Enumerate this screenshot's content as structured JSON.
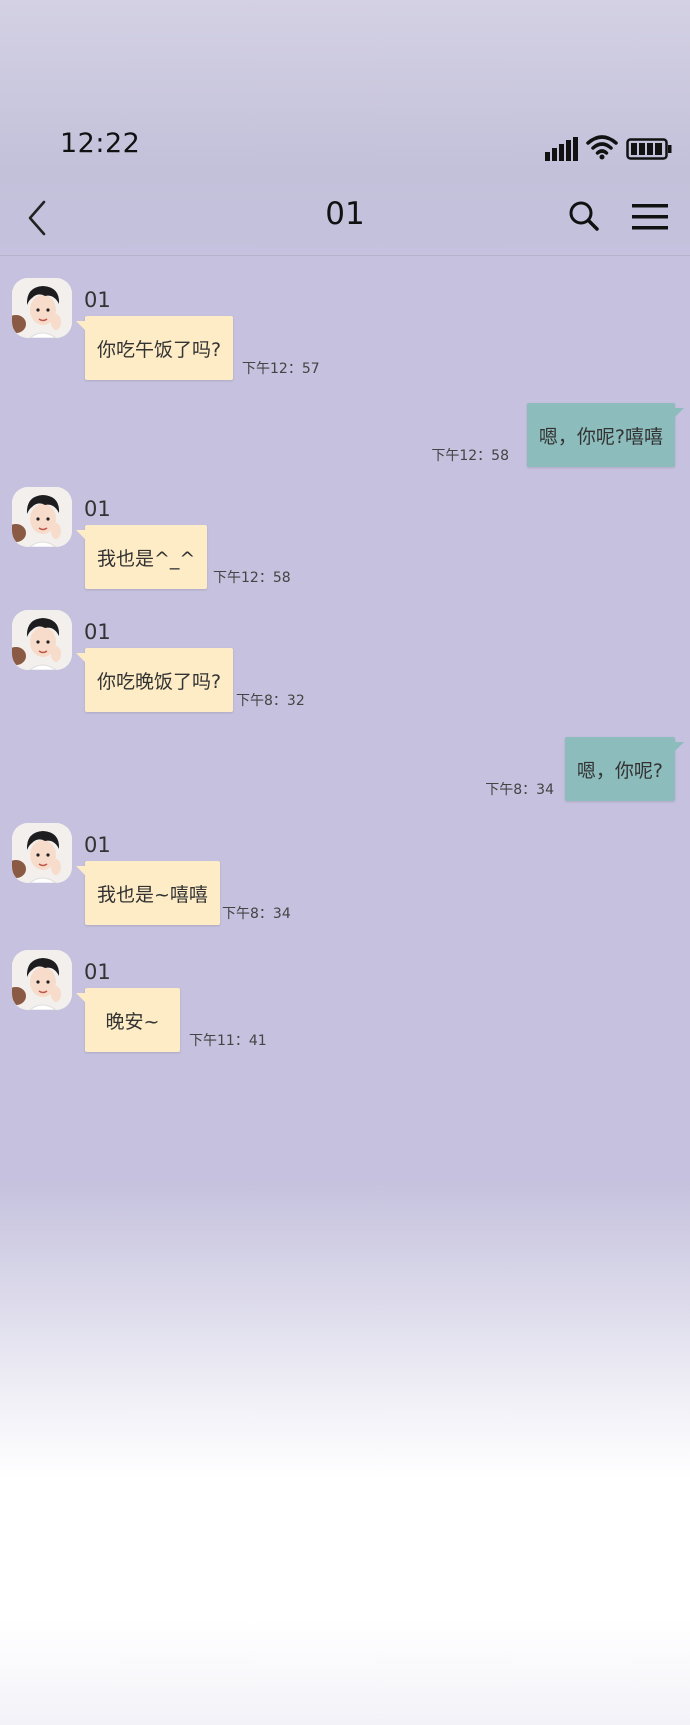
{
  "status_bar": {
    "time": "12:22",
    "icons": [
      "signal-icon",
      "wifi-icon",
      "battery-icon"
    ]
  },
  "navbar": {
    "title": "01",
    "icons": [
      "back-icon",
      "search-icon",
      "menu-icon"
    ]
  },
  "colors": {
    "incoming_bubble": "#fdecc6",
    "outgoing_bubble": "#8cbcbc",
    "background": "#c5c1de"
  },
  "messages": [
    {
      "direction": "in",
      "sender": "01",
      "text": "你吃午饭了吗?",
      "time": "下午12：57"
    },
    {
      "direction": "out",
      "text": "嗯，你呢?嘻嘻",
      "time": "下午12：58"
    },
    {
      "direction": "in",
      "sender": "01",
      "text": "我也是^_^",
      "time": "下午12：58"
    },
    {
      "direction": "in",
      "sender": "01",
      "text": "你吃晚饭了吗?",
      "time": "下午8：32"
    },
    {
      "direction": "out",
      "text": "嗯，你呢?",
      "time": "下午8：34"
    },
    {
      "direction": "in",
      "sender": "01",
      "text": "我也是~嘻嘻",
      "time": "下午8：34"
    },
    {
      "direction": "in",
      "sender": "01",
      "text": "晚安~",
      "time": "下午11：41"
    }
  ]
}
